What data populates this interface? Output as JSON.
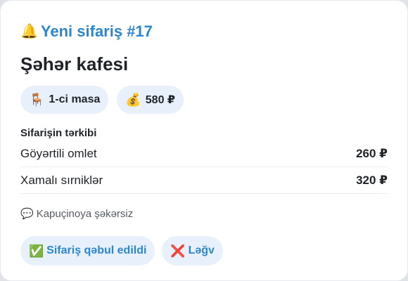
{
  "header": {
    "icon": "bell-icon",
    "icon_glyph": "🔔",
    "title": "Yeni sifariş #17"
  },
  "place": {
    "name": "Şəhər kafesi"
  },
  "chips": {
    "table": {
      "icon": "chair-icon",
      "icon_glyph": "🪑",
      "label": "1-ci masa"
    },
    "total": {
      "icon": "money-bag-icon",
      "icon_glyph": "💰",
      "label": "580 ₽"
    }
  },
  "order": {
    "section_title": "Sifarişin tərkibi",
    "items": [
      {
        "name": "Göyərtili omlet",
        "price": "260 ₽"
      },
      {
        "name": "Xamalı sırniklər",
        "price": "320 ₽"
      }
    ]
  },
  "note": {
    "icon": "speech-bubble-icon",
    "icon_glyph": "💬",
    "text": "Kapuçinoya şəkərsiz"
  },
  "actions": {
    "accept": {
      "icon": "check-mark-icon",
      "icon_glyph": "✅",
      "label": "Sifariş qəbul edildi"
    },
    "cancel": {
      "icon": "cross-mark-icon",
      "icon_glyph": "❌",
      "label": "Ləğv"
    }
  },
  "colors": {
    "accent": "#2b86cf",
    "chip_bg": "#e8f1fb",
    "text": "#1f2328"
  }
}
